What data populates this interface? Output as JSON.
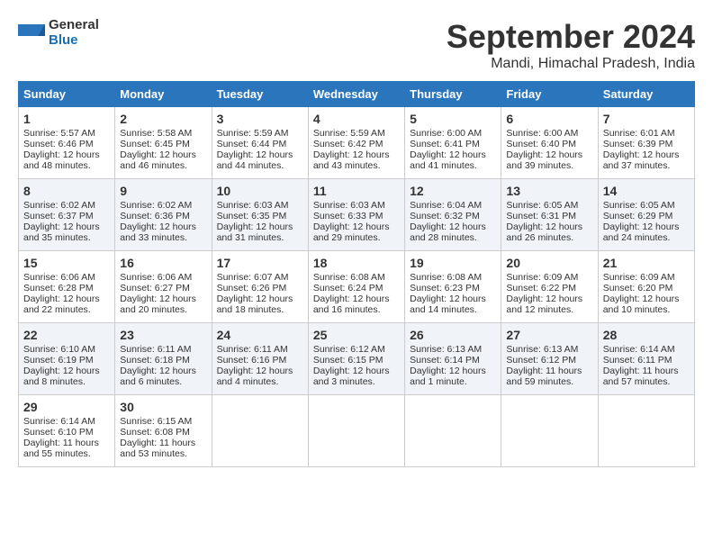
{
  "logo": {
    "general": "General",
    "blue": "Blue"
  },
  "title": "September 2024",
  "location": "Mandi, Himachal Pradesh, India",
  "headers": [
    "Sunday",
    "Monday",
    "Tuesday",
    "Wednesday",
    "Thursday",
    "Friday",
    "Saturday"
  ],
  "weeks": [
    [
      {
        "day": "1",
        "sunrise": "Sunrise: 5:57 AM",
        "sunset": "Sunset: 6:46 PM",
        "daylight": "Daylight: 12 hours and 48 minutes."
      },
      {
        "day": "2",
        "sunrise": "Sunrise: 5:58 AM",
        "sunset": "Sunset: 6:45 PM",
        "daylight": "Daylight: 12 hours and 46 minutes."
      },
      {
        "day": "3",
        "sunrise": "Sunrise: 5:59 AM",
        "sunset": "Sunset: 6:44 PM",
        "daylight": "Daylight: 12 hours and 44 minutes."
      },
      {
        "day": "4",
        "sunrise": "Sunrise: 5:59 AM",
        "sunset": "Sunset: 6:42 PM",
        "daylight": "Daylight: 12 hours and 43 minutes."
      },
      {
        "day": "5",
        "sunrise": "Sunrise: 6:00 AM",
        "sunset": "Sunset: 6:41 PM",
        "daylight": "Daylight: 12 hours and 41 minutes."
      },
      {
        "day": "6",
        "sunrise": "Sunrise: 6:00 AM",
        "sunset": "Sunset: 6:40 PM",
        "daylight": "Daylight: 12 hours and 39 minutes."
      },
      {
        "day": "7",
        "sunrise": "Sunrise: 6:01 AM",
        "sunset": "Sunset: 6:39 PM",
        "daylight": "Daylight: 12 hours and 37 minutes."
      }
    ],
    [
      {
        "day": "8",
        "sunrise": "Sunrise: 6:02 AM",
        "sunset": "Sunset: 6:37 PM",
        "daylight": "Daylight: 12 hours and 35 minutes."
      },
      {
        "day": "9",
        "sunrise": "Sunrise: 6:02 AM",
        "sunset": "Sunset: 6:36 PM",
        "daylight": "Daylight: 12 hours and 33 minutes."
      },
      {
        "day": "10",
        "sunrise": "Sunrise: 6:03 AM",
        "sunset": "Sunset: 6:35 PM",
        "daylight": "Daylight: 12 hours and 31 minutes."
      },
      {
        "day": "11",
        "sunrise": "Sunrise: 6:03 AM",
        "sunset": "Sunset: 6:33 PM",
        "daylight": "Daylight: 12 hours and 29 minutes."
      },
      {
        "day": "12",
        "sunrise": "Sunrise: 6:04 AM",
        "sunset": "Sunset: 6:32 PM",
        "daylight": "Daylight: 12 hours and 28 minutes."
      },
      {
        "day": "13",
        "sunrise": "Sunrise: 6:05 AM",
        "sunset": "Sunset: 6:31 PM",
        "daylight": "Daylight: 12 hours and 26 minutes."
      },
      {
        "day": "14",
        "sunrise": "Sunrise: 6:05 AM",
        "sunset": "Sunset: 6:29 PM",
        "daylight": "Daylight: 12 hours and 24 minutes."
      }
    ],
    [
      {
        "day": "15",
        "sunrise": "Sunrise: 6:06 AM",
        "sunset": "Sunset: 6:28 PM",
        "daylight": "Daylight: 12 hours and 22 minutes."
      },
      {
        "day": "16",
        "sunrise": "Sunrise: 6:06 AM",
        "sunset": "Sunset: 6:27 PM",
        "daylight": "Daylight: 12 hours and 20 minutes."
      },
      {
        "day": "17",
        "sunrise": "Sunrise: 6:07 AM",
        "sunset": "Sunset: 6:26 PM",
        "daylight": "Daylight: 12 hours and 18 minutes."
      },
      {
        "day": "18",
        "sunrise": "Sunrise: 6:08 AM",
        "sunset": "Sunset: 6:24 PM",
        "daylight": "Daylight: 12 hours and 16 minutes."
      },
      {
        "day": "19",
        "sunrise": "Sunrise: 6:08 AM",
        "sunset": "Sunset: 6:23 PM",
        "daylight": "Daylight: 12 hours and 14 minutes."
      },
      {
        "day": "20",
        "sunrise": "Sunrise: 6:09 AM",
        "sunset": "Sunset: 6:22 PM",
        "daylight": "Daylight: 12 hours and 12 minutes."
      },
      {
        "day": "21",
        "sunrise": "Sunrise: 6:09 AM",
        "sunset": "Sunset: 6:20 PM",
        "daylight": "Daylight: 12 hours and 10 minutes."
      }
    ],
    [
      {
        "day": "22",
        "sunrise": "Sunrise: 6:10 AM",
        "sunset": "Sunset: 6:19 PM",
        "daylight": "Daylight: 12 hours and 8 minutes."
      },
      {
        "day": "23",
        "sunrise": "Sunrise: 6:11 AM",
        "sunset": "Sunset: 6:18 PM",
        "daylight": "Daylight: 12 hours and 6 minutes."
      },
      {
        "day": "24",
        "sunrise": "Sunrise: 6:11 AM",
        "sunset": "Sunset: 6:16 PM",
        "daylight": "Daylight: 12 hours and 4 minutes."
      },
      {
        "day": "25",
        "sunrise": "Sunrise: 6:12 AM",
        "sunset": "Sunset: 6:15 PM",
        "daylight": "Daylight: 12 hours and 3 minutes."
      },
      {
        "day": "26",
        "sunrise": "Sunrise: 6:13 AM",
        "sunset": "Sunset: 6:14 PM",
        "daylight": "Daylight: 12 hours and 1 minute."
      },
      {
        "day": "27",
        "sunrise": "Sunrise: 6:13 AM",
        "sunset": "Sunset: 6:12 PM",
        "daylight": "Daylight: 11 hours and 59 minutes."
      },
      {
        "day": "28",
        "sunrise": "Sunrise: 6:14 AM",
        "sunset": "Sunset: 6:11 PM",
        "daylight": "Daylight: 11 hours and 57 minutes."
      }
    ],
    [
      {
        "day": "29",
        "sunrise": "Sunrise: 6:14 AM",
        "sunset": "Sunset: 6:10 PM",
        "daylight": "Daylight: 11 hours and 55 minutes."
      },
      {
        "day": "30",
        "sunrise": "Sunrise: 6:15 AM",
        "sunset": "Sunset: 6:08 PM",
        "daylight": "Daylight: 11 hours and 53 minutes."
      },
      null,
      null,
      null,
      null,
      null
    ]
  ]
}
